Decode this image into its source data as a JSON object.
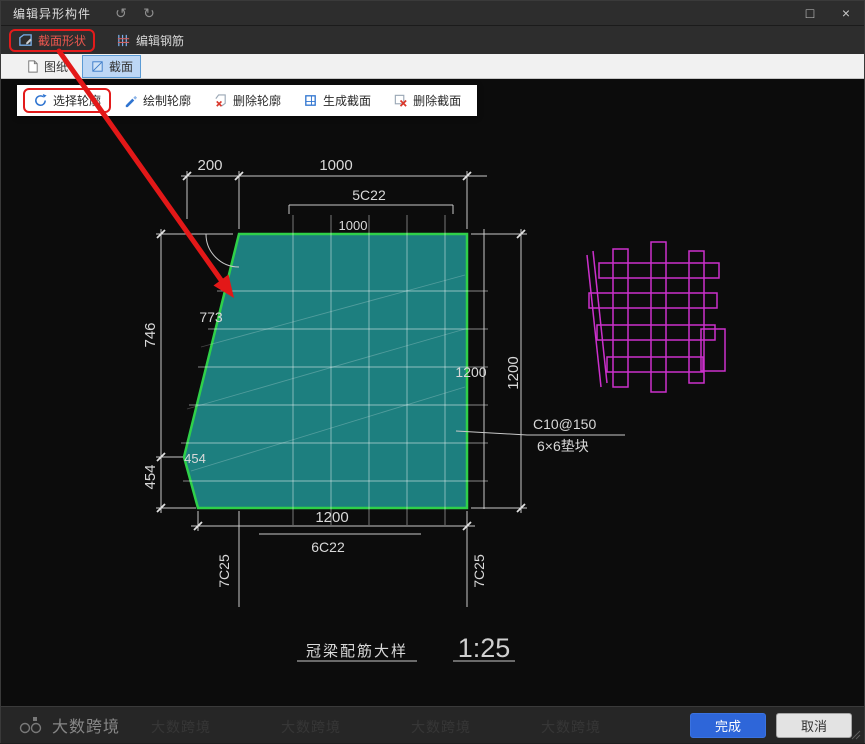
{
  "window": {
    "title": "编辑异形构件",
    "undo_icon": "↺",
    "redo_icon": "↻",
    "maximize_icon": "□",
    "close_icon": "×"
  },
  "main_toolbar": {
    "section_shape": "截面形状",
    "edit_rebar": "编辑钢筋"
  },
  "tab_bar": {
    "drawing_tab": "图纸",
    "section_tab": "截面"
  },
  "outline_toolbar": {
    "select_outline": "选择轮廓",
    "draw_outline": "绘制轮廓",
    "delete_outline": "删除轮廓",
    "generate_section": "生成截面",
    "delete_section": "删除截面"
  },
  "drawing": {
    "dims": {
      "top_offset": "200",
      "top_width": "1000",
      "top_rebar": "5C22",
      "top_inner_width": "1000",
      "slant_length": "773",
      "left_upper": "746",
      "left_lower_v": "454",
      "left_lower_h": "454",
      "right_inner_height": "1200",
      "right_outer_height": "1200",
      "bottom_width": "1200",
      "bottom_rebar": "6C22",
      "left_corner_rebar": "7C25",
      "right_corner_rebar": "7C25",
      "stirrup_note": "C10@150",
      "spacer_note": "6×6垫块"
    },
    "caption": "冠梁配筋大样",
    "scale": "1:25"
  },
  "footer": {
    "finish_button": "完成",
    "cancel_button": "取消",
    "watermark": "大数跨境"
  },
  "colors": {
    "accent_blue": "#2E66D9",
    "annotation_red": "#E31B1B",
    "section_fill_teal": "#229C9C",
    "outline_green": "#2FD04A",
    "rebar_magenta": "#CB30CB"
  }
}
